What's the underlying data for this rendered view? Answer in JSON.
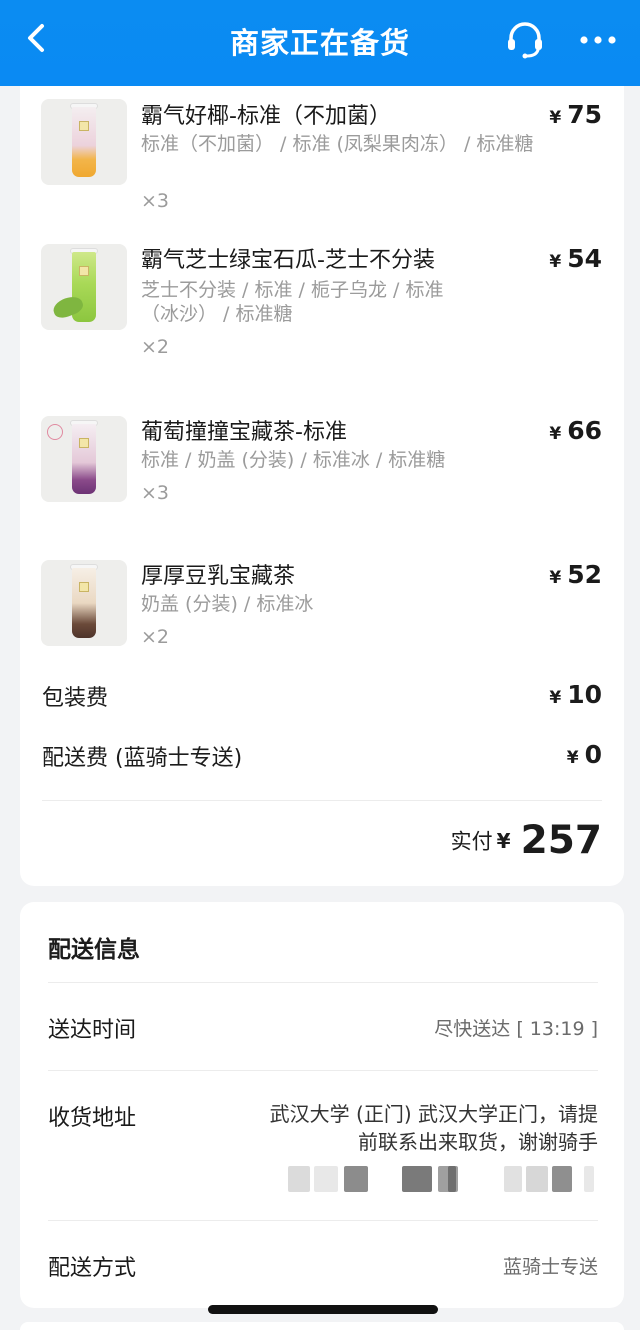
{
  "header": {
    "title": "商家正在备货",
    "back_icon": "chevron-left-icon",
    "support_icon": "headset-icon",
    "more_icon": "more-dots-icon"
  },
  "order_items": [
    {
      "name": "霸气好椰-标准（不加菌）",
      "spec": "标准（不加菌） / 标准 (凤梨果肉冻） / 标准糖",
      "qty": "×3",
      "currency": "¥",
      "price": "75"
    },
    {
      "name": "霸气芝士绿宝石瓜-芝士不分装",
      "spec": "芝士不分装 / 标准 / 栀子乌龙 / 标准（冰沙） / 标准糖",
      "qty": "×2",
      "currency": "¥",
      "price": "54"
    },
    {
      "name": "葡萄撞撞宝藏茶-标准",
      "spec": "标准 / 奶盖 (分装) / 标准冰 / 标准糖",
      "qty": "×3",
      "currency": "¥",
      "price": "66"
    },
    {
      "name": "厚厚豆乳宝藏茶",
      "spec": "奶盖 (分装) / 标准冰",
      "qty": "×2",
      "currency": "¥",
      "price": "52"
    }
  ],
  "fees": {
    "packaging_label": "包装费",
    "packaging_currency": "¥",
    "packaging_value": "10",
    "delivery_label": "配送费 (蓝骑士专送)",
    "delivery_currency": "¥",
    "delivery_value": "0"
  },
  "total": {
    "label": "实付",
    "currency": "¥",
    "amount": "257"
  },
  "delivery_info": {
    "title": "配送信息",
    "time_label": "送达时间",
    "time_value": "尽快送达 [ 13:19 ]",
    "address_label": "收货地址",
    "address_line1": "武汉大学 (正门) 武汉大学正门，请提",
    "address_line2": "前联系出来取货，谢谢骑手",
    "method_label": "配送方式",
    "method_value": "蓝骑士专送"
  },
  "colors": {
    "header_blue": "#0b8cf2",
    "background": "#f2f3f5",
    "card": "#ffffff",
    "text_muted": "#9b9b9b"
  }
}
